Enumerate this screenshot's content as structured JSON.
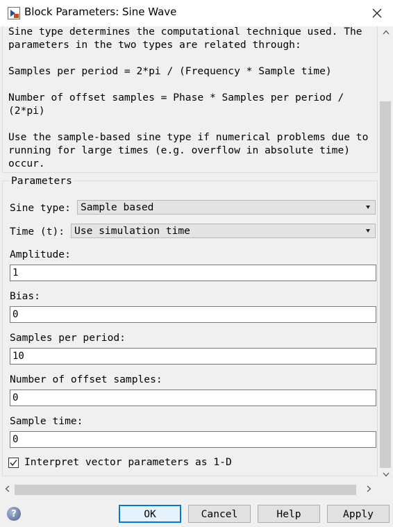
{
  "window": {
    "title": "Block Parameters: Sine Wave",
    "icons": {
      "app": "simulink-block-icon",
      "close": "close-icon"
    }
  },
  "description": {
    "lines": [
      "Sine type determines the computational technique used. The",
      "parameters in the two types are related through:",
      "Samples per period = 2*pi / (Frequency * Sample time)",
      "Number of offset samples = Phase * Samples per period /",
      "(2*pi)",
      "Use the sample-based sine type if numerical problems due to",
      "running for large times (e.g. overflow in absolute time)",
      "occur."
    ]
  },
  "parameters": {
    "group_title": "Parameters",
    "sine_type": {
      "label": "Sine type:",
      "value": "Sample based"
    },
    "time": {
      "label": "Time (t):",
      "value": "Use simulation time"
    },
    "amplitude": {
      "label": "Amplitude:",
      "value": "1"
    },
    "bias": {
      "label": "Bias:",
      "value": "0"
    },
    "samples_per_period": {
      "label": "Samples per period:",
      "value": "10"
    },
    "offset_samples": {
      "label": "Number of offset samples:",
      "value": "0"
    },
    "sample_time": {
      "label": "Sample time:",
      "value": "0"
    },
    "interpret_vector": {
      "label": "Interpret vector parameters as 1-D",
      "checked": true
    }
  },
  "buttons": {
    "ok": "OK",
    "cancel": "Cancel",
    "help": "Help",
    "apply": "Apply"
  },
  "colors": {
    "dialog_bg": "#f0f0f0",
    "default_button_border": "#0078d7",
    "scroll_thumb": "#cdcdcd"
  }
}
